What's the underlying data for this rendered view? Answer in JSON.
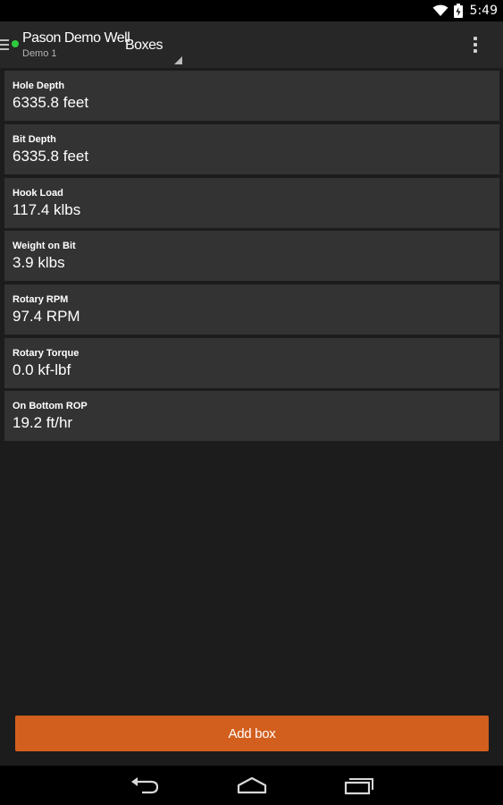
{
  "status_bar": {
    "time": "5:49",
    "icons": [
      "wifi-icon",
      "battery-icon"
    ]
  },
  "action_bar": {
    "menu_icon": "hamburger-menu-icon",
    "connection_status_color": "#2ecc40",
    "well_name": "Pason Demo Well",
    "well_subtitle": "Demo 1",
    "view_selector": "Boxes",
    "overflow_icon": "more-vertical-icon"
  },
  "boxes": [
    {
      "title": "Hole Depth",
      "value": "6335.8 feet"
    },
    {
      "title": "Bit Depth",
      "value": "6335.8 feet"
    },
    {
      "title": "Hook Load",
      "value": "117.4 klbs"
    },
    {
      "title": "Weight on Bit",
      "value": "3.9 klbs"
    },
    {
      "title": "Rotary RPM",
      "value": "97.4 RPM"
    },
    {
      "title": "Rotary Torque",
      "value": "0.0 kf-lbf"
    },
    {
      "title": "On Bottom ROP",
      "value": "19.2 ft/hr"
    }
  ],
  "add_box_label": "Add box",
  "accent_color": "#d25f1e",
  "nav_bar": {
    "icons": [
      "back-icon",
      "home-icon",
      "recent-apps-icon"
    ]
  }
}
